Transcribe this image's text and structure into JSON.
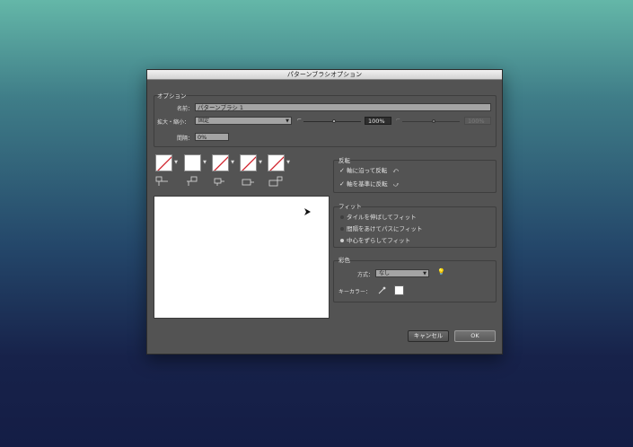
{
  "dialog": {
    "title": "パターンブラシオプション",
    "options": {
      "group_label": "オプション",
      "name_label": "名前：",
      "name_value": "パターンブラシ 1",
      "scale_label": "拡大・縮小：",
      "scale_select": "固定",
      "scale_percent": "100%",
      "scale_percent_max": "100%",
      "spacing_label": "間隔：",
      "spacing_value": "0%"
    },
    "flip": {
      "group_label": "反転",
      "along": "軸に沿って反転",
      "across": "軸を基準に反転"
    },
    "fit": {
      "group_label": "フィット",
      "stretch": "タイルを伸ばしてフィット",
      "add_space": "間隔をあけてパスにフィット",
      "approximate": "中心をずらしてフィット",
      "selected": "approximate"
    },
    "colorization": {
      "group_label": "彩色",
      "method_label": "方式：",
      "method_value": "なし",
      "key_color_label": "キーカラー：",
      "key_color": "#ffffff"
    },
    "buttons": {
      "cancel": "キャンセル",
      "ok": "OK"
    },
    "icons": {
      "swatch_icon": "none-swatch",
      "tip_icon": "lightbulb-icon",
      "eyedropper": "eyedropper-icon"
    }
  }
}
